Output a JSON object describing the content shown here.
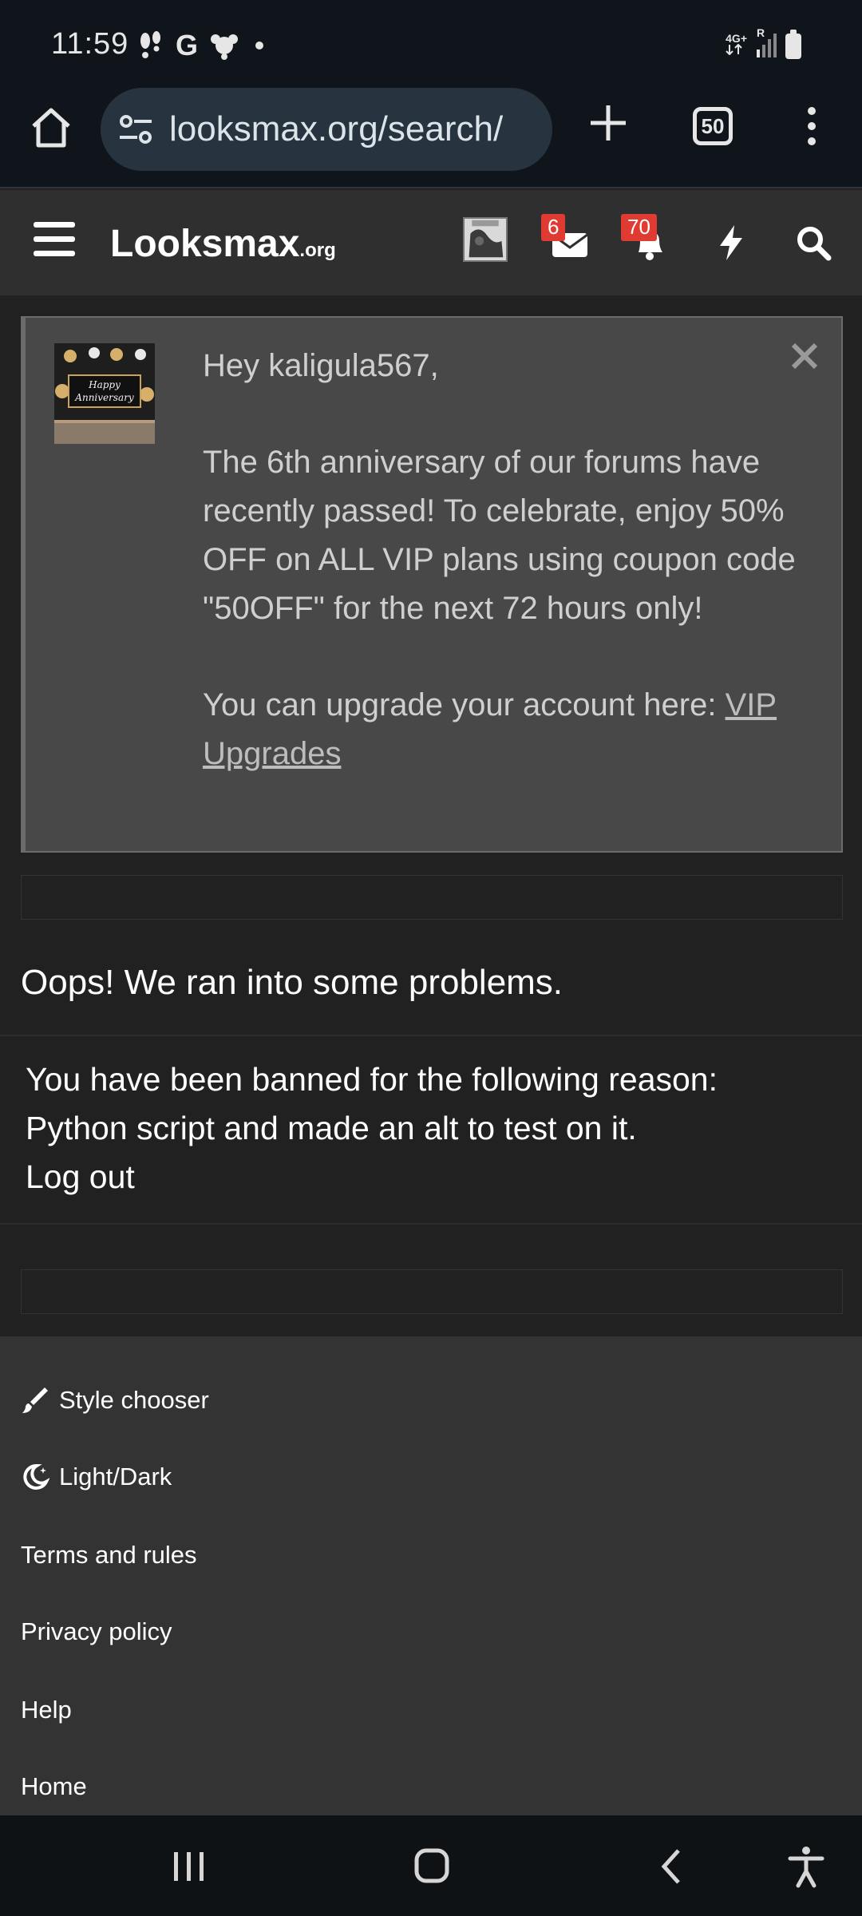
{
  "status_bar": {
    "time": "11:59",
    "network_label": "4G+",
    "roaming_label": "R"
  },
  "browser": {
    "url": "looksmax.org/search/",
    "tab_count": "50"
  },
  "site_header": {
    "logo_main": "Looksmax",
    "logo_suffix": ".org",
    "inbox_badge": "6",
    "alerts_badge": "70"
  },
  "notice": {
    "greeting": "Hey kaligula567,",
    "body": "The 6th anniversary of our forums have recently passed! To celebrate, enjoy 50% OFF on ALL VIP plans using coupon code \"50OFF\" for the next 72 hours only!",
    "upgrade_prefix": "You can upgrade your account here: ",
    "upgrade_link": "VIP Upgrades",
    "image_line1": "Happy",
    "image_line2": "Anniversary"
  },
  "error": {
    "title": "Oops! We ran into some problems.",
    "ban_reason_line": "You have been banned for the following reason:",
    "ban_reason": "Python script and made an alt to test on it.",
    "logout_label": "Log out"
  },
  "footer": {
    "style_chooser": "Style chooser",
    "light_dark": "Light/Dark",
    "terms": "Terms and rules",
    "privacy": "Privacy policy",
    "help": "Help",
    "home": "Home"
  },
  "colors": {
    "page_bg": "#212121",
    "header_bg": "#2f2f2f",
    "notice_bg": "#484848",
    "badge_red": "#e03b32",
    "browser_bg": "#0f151b"
  },
  "icons": {
    "home": "home-icon",
    "site_settings": "tune-icon",
    "new_tab": "plus-icon",
    "menu": "more-vertical-icon",
    "hamburger": "hamburger-icon",
    "inbox": "envelope-icon",
    "alerts": "bell-icon",
    "whats_new": "bolt-icon",
    "search": "search-icon",
    "close": "close-icon",
    "brush": "brush-icon",
    "moon": "moon-icon"
  }
}
